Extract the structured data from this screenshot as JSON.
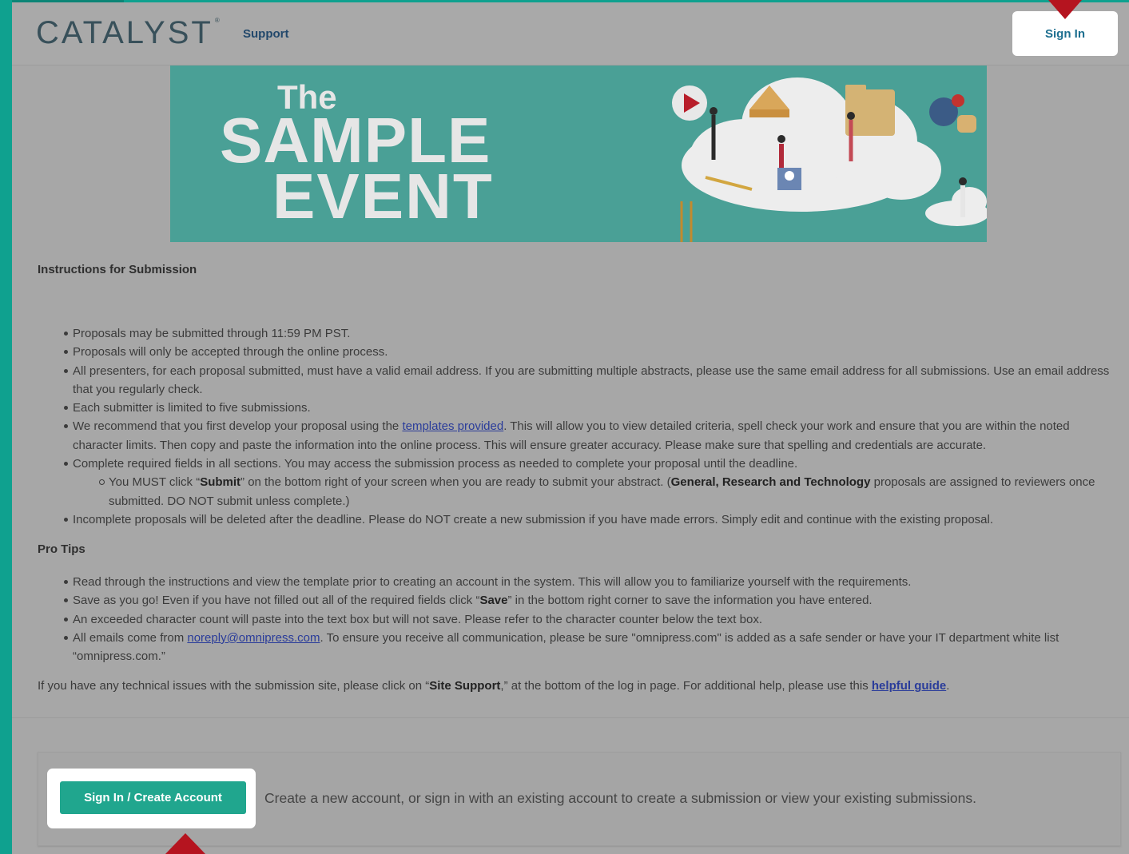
{
  "header": {
    "logo": "CATALYST",
    "logo_mark": "®",
    "support_link": "Support",
    "sign_in": "Sign In"
  },
  "banner": {
    "line1": "The",
    "line2": "SAMPLE",
    "line3": "EVENT"
  },
  "instructions": {
    "heading": "Instructions for Submission",
    "items": [
      "Proposals may be submitted through 11:59 PM PST.",
      "Proposals will only be accepted through the online process.",
      "All presenters, for each proposal submitted, must have a valid email address. If you are submitting multiple abstracts, please use the same email address for all submissions. Use an email address that you regularly check.",
      "Each submitter is limited to five submissions."
    ],
    "recommend_pre": "We recommend that you first develop your proposal using the ",
    "recommend_link": "templates provided",
    "recommend_post": ". This will allow you to view detailed criteria, spell check your work and ensure that you are within the noted character limits. Then copy and paste the information into the online process. This will ensure greater accuracy. Please make sure that spelling and credentials are accurate.",
    "complete": "Complete required fields in all sections. You may access the submission process as needed to complete your proposal until the deadline.",
    "sub_pre": "You MUST click “",
    "sub_submit": "Submit",
    "sub_mid": "” on the bottom right of your screen when you are ready to submit your abstract. (",
    "sub_types": "General, Research and Technology",
    "sub_post": " proposals are assigned to reviewers once submitted. DO NOT submit unless complete.)",
    "incomplete": "Incomplete proposals will be deleted after the deadline. Please do NOT create a new submission if you have made errors. Simply edit and continue with the existing proposal."
  },
  "tips": {
    "heading": "Pro Tips",
    "read": "Read through the instructions and view the template prior to creating an account in the system. This will allow you to familiarize yourself with the requirements.",
    "save_pre": "Save as you go! Even if you have not filled out all of the required fields click “",
    "save_bold": "Save",
    "save_post": "” in the bottom right corner to save the information you have entered.",
    "exceeded": "An exceeded character count will paste into the text box but will not save. Please refer to the character counter below the text box.",
    "emails_pre": "All emails come from ",
    "emails_link": "noreply@omnipress.com",
    "emails_post": ". To ensure you receive all communication, please be sure \"omnipress.com\" is added as a safe sender or have your IT department white list “omnipress.com.”"
  },
  "help": {
    "pre": "If you have any technical issues with the submission site, please click on “",
    "site_support": "Site Support",
    "mid": ",” at the bottom of the log in page. For additional help, please use this ",
    "guide": "helpful guide",
    "post": "."
  },
  "panel": {
    "button": "Sign In / Create Account",
    "text": "Create a new account, or sign in with an existing account to create a submission or view your existing submissions."
  },
  "colors": {
    "accent_teal": "#0fa18f",
    "button_green": "#20a68e",
    "pointer_red": "#b5141f",
    "banner_teal": "#4aa096"
  }
}
